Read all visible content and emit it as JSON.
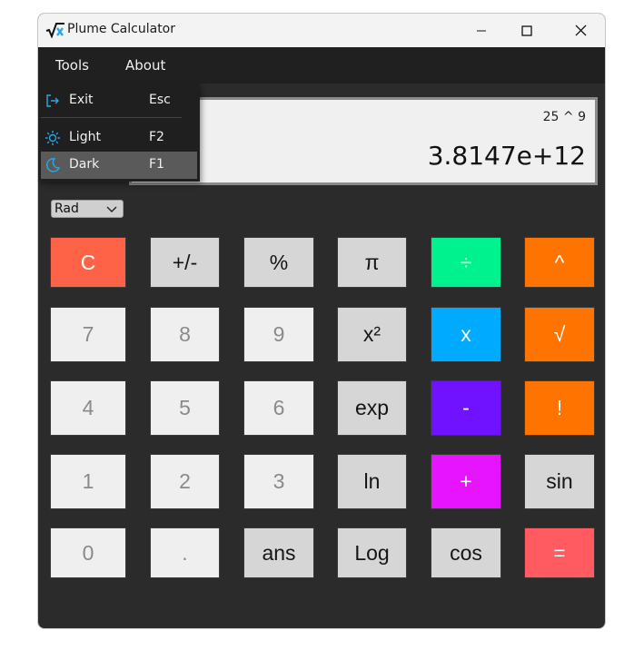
{
  "window": {
    "title": "Plume Calculator"
  },
  "menu": {
    "tools": "Tools",
    "about": "About"
  },
  "tools_menu": {
    "items": [
      {
        "label": "Exit",
        "shortcut": "Esc",
        "icon": "exit-icon"
      },
      {
        "label": "Light",
        "shortcut": "F2",
        "icon": "sun-icon"
      },
      {
        "label": "Dark",
        "shortcut": "F1",
        "icon": "moon-icon",
        "selected": true
      }
    ]
  },
  "display": {
    "expression": "25 ^ 9",
    "result": "3.8147e+12"
  },
  "angle_mode": {
    "selected": "Rad"
  },
  "keypad": {
    "clear": "C",
    "negate": "+/-",
    "percent": "%",
    "pi": "π",
    "divide": "÷",
    "power": "^",
    "seven": "7",
    "eight": "8",
    "nine": "9",
    "square": "x²",
    "multiply": "x",
    "sqrt": "√",
    "four": "4",
    "five": "5",
    "six": "6",
    "exp": "exp",
    "subtract": "-",
    "factorial": "!",
    "one": "1",
    "two": "2",
    "three": "3",
    "ln": "ln",
    "add": "+",
    "sin": "sin",
    "zero": "0",
    "decimal": ".",
    "ans": "ans",
    "log": "Log",
    "cos": "cos",
    "equals": "="
  },
  "colors": {
    "clear": "#ff6347",
    "divide": "#00f28e",
    "multiply": "#00aaff",
    "subtract": "#7011ff",
    "add": "#e614ff",
    "orange_ops": "#ff7400",
    "equals": "#ff5b60",
    "accent_icon": "#29a8e8"
  }
}
